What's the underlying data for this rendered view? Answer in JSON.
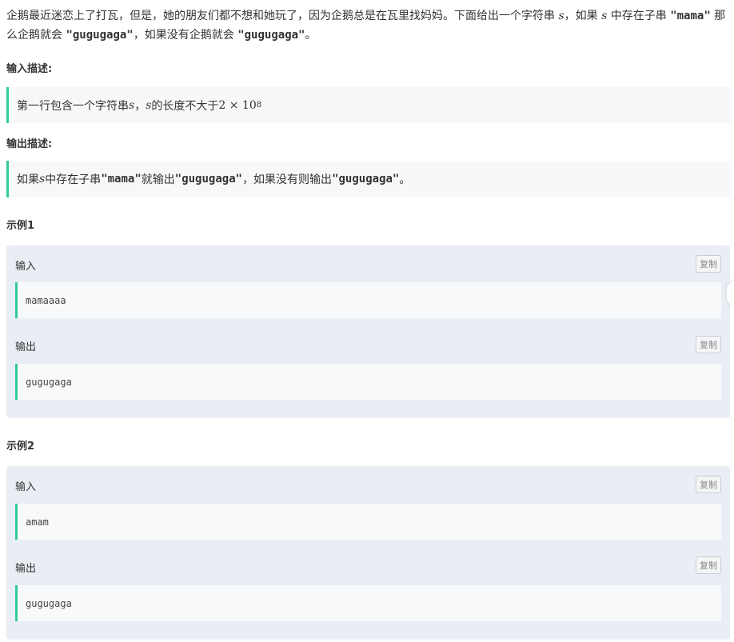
{
  "problem": {
    "desc_p1": "企鹅最近迷恋上了打瓦，但是，她的朋友们都不想和她玩了，因为企鹅总是在瓦里找妈妈。下面给出一个字符串 ",
    "desc_var1": "s",
    "desc_p2": "，如果 ",
    "desc_var2": "s",
    "desc_p3": " 中存在子串 ",
    "desc_code1": "\"mama\"",
    "desc_p4": " 那么企鹅就会 ",
    "desc_code2": "\"gugugaga\"",
    "desc_p5": "，如果没有企鹅就会 ",
    "desc_code3": "\"gugugaga\"",
    "desc_p6": "。"
  },
  "input_section": {
    "heading": "输入描述:",
    "t1": "第一行包含一个字符串 ",
    "var1": "s",
    "t2": "，",
    "var2": "s",
    "t3": " 的长度不大于 ",
    "math_base": "2 × 10",
    "math_exp": "8"
  },
  "output_section": {
    "heading": "输出描述:",
    "t1": "如果 ",
    "var1": "s",
    "t2": " 中存在子串 ",
    "code1": "\"mama\"",
    "t3": " 就输出 ",
    "code2": "\"gugugaga\"",
    "t4": "，如果没有则输出 ",
    "code3": "\"gugugaga\"",
    "t5": "。"
  },
  "examples": [
    {
      "title": "示例1",
      "input_label": "输入",
      "input": "mamaaaa",
      "output_label": "输出",
      "output": "gugugaga",
      "copy_label": "复制"
    },
    {
      "title": "示例2",
      "input_label": "输入",
      "input": "amam",
      "output_label": "输出",
      "output": "gugugaga",
      "copy_label": "复制"
    }
  ]
}
